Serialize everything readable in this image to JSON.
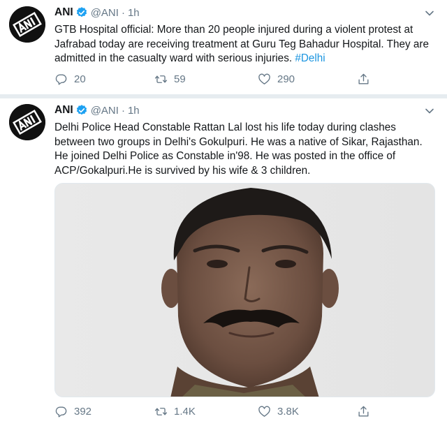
{
  "tweets": [
    {
      "author": "ANI",
      "handle": "@ANI",
      "separator": "·",
      "time": "1h",
      "text": "GTB Hospital official: More than 20 people injured during a violent protest at Jafrabad today are receiving treatment at Guru Teg Bahadur Hospital. They are admitted in the casualty ward with serious injuries. ",
      "hashtag": "#Delhi",
      "replies": "20",
      "retweets": "59",
      "likes": "290"
    },
    {
      "author": "ANI",
      "handle": "@ANI",
      "separator": "·",
      "time": "1h",
      "text": "Delhi Police Head Constable Rattan Lal lost his life today during clashes between two groups in Delhi's Gokulpuri. He was a native of Sikar, Rajasthan. He joined Delhi Police as Constable in'98. He was posted in the office of ACP/Gokalpuri.He is survived by his wife & 3 children.",
      "replies": "392",
      "retweets": "1.4K",
      "likes": "3.8K"
    }
  ],
  "icons": {
    "verified": "verified-badge-icon",
    "caret": "chevron-down-icon",
    "reply": "reply-icon",
    "retweet": "retweet-icon",
    "like": "heart-icon",
    "share": "share-icon"
  },
  "colors": {
    "accent": "#1da1f2",
    "hashtag": "#1b95e0",
    "secondary_text": "#657786",
    "divider": "#e6ecf0"
  }
}
